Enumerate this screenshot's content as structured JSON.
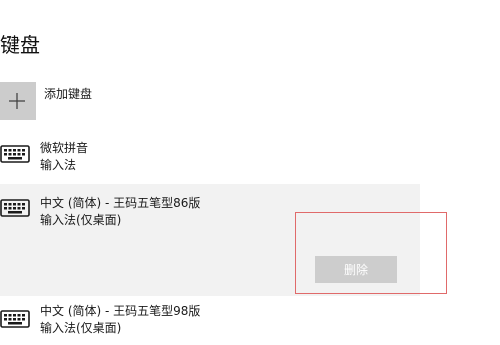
{
  "page": {
    "title": "键盘"
  },
  "add_keyboard": {
    "label": "添加键盘",
    "icon": "plus-icon"
  },
  "keyboards": [
    {
      "name": "微软拼音",
      "type": "输入法",
      "icon": "keyboard-icon"
    },
    {
      "name": "中文 (简体) - 王码五笔型86版",
      "type": "输入法(仅桌面)",
      "icon": "keyboard-icon"
    },
    {
      "name": "中文 (简体) - 王码五笔型98版",
      "type": "输入法(仅桌面)",
      "icon": "keyboard-icon"
    }
  ],
  "selected_item": {
    "delete_label": "删除"
  },
  "colors": {
    "selected_background": "#f2f2f2",
    "highlight_border": "#e06a6a",
    "disabled_button": "#cdcdcd"
  }
}
